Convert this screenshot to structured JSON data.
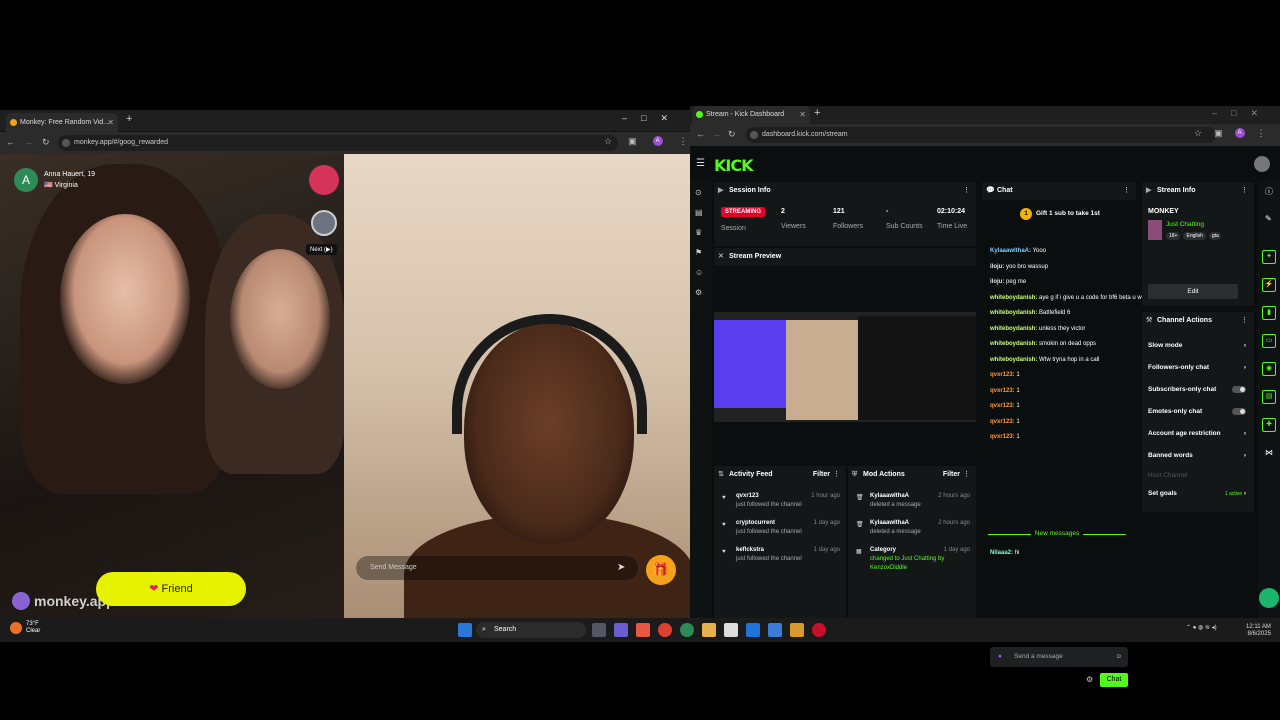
{
  "left_browser": {
    "tab_title": "Monkey: Free Random Vid...",
    "url": "monkey.app/#/goog_rewarded",
    "user_name": "Anna Hauert, 19",
    "user_location": "🇺🇸 Virginia",
    "user_initial": "A",
    "next_tooltip": "Next (▶)",
    "friend_label": "Friend",
    "logo_text": "monkey.app",
    "send_placeholder": "Send Message"
  },
  "right_browser": {
    "tab_title": "Stream - Kick Dashboard",
    "url": "dashboard.kick.com/stream",
    "kick_logo": "KICK",
    "session_info": {
      "title": "Session Info",
      "status": "STREAMING",
      "session_label": "Session",
      "viewers_value": "2",
      "viewers_label": "Viewers",
      "followers_value": "121",
      "followers_label": "Followers",
      "subs_value": "-",
      "subs_label": "Sub Counts",
      "time_value": "02:10:24",
      "time_label": "Time Live"
    },
    "stream_preview_title": "Stream Preview",
    "activity_feed": {
      "title": "Activity Feed",
      "filter": "Filter",
      "items": [
        {
          "name": "qvxr123",
          "text": "just followed the channel",
          "time": "1 hour ago"
        },
        {
          "name": "cryptocurrent",
          "text": "just followed the channel",
          "time": "1 day ago"
        },
        {
          "name": "keflckstra",
          "text": "just followed the channel",
          "time": "1 day ago"
        }
      ]
    },
    "mod_actions": {
      "title": "Mod Actions",
      "filter": "Filter",
      "items": [
        {
          "name": "KylaaawithaA",
          "text": "deleted a message",
          "time": "2 hours ago"
        },
        {
          "name": "KylaaawithaA",
          "text": "deleted a message",
          "time": "2 hours ago"
        },
        {
          "name": "Category",
          "text": "changed to Just Chatting by KenzoxDiddle",
          "time": "1 day ago"
        }
      ]
    },
    "chat": {
      "title": "Chat",
      "pinned": "Gift 1 sub to take 1st",
      "lines": [
        {
          "user": "KylaaawithaA:",
          "msg": "Yooo",
          "color": "#7fd0ff"
        },
        {
          "user": "iloju:",
          "msg": "yoo bro wassup",
          "color": "#e8e8e8"
        },
        {
          "user": "iloju:",
          "msg": "peg me",
          "color": "#e8e8e8"
        },
        {
          "user": "whiteboydanish:",
          "msg": "aye g if i give u a code for bf6 beta u would play wit me",
          "color": "#c8ff7a"
        },
        {
          "user": "whiteboydanish:",
          "msg": "Battlefield 6",
          "color": "#c8ff7a"
        },
        {
          "user": "whiteboydanish:",
          "msg": "unless they victor",
          "color": "#c8ff7a"
        },
        {
          "user": "whiteboydanish:",
          "msg": "smokin on dead opps",
          "color": "#c8ff7a"
        },
        {
          "user": "whiteboydanish:",
          "msg": "Wtw tryna hop in a call",
          "color": "#c8ff7a"
        },
        {
          "user": "qvxr123:",
          "msg": "1",
          "color": "#ff9a3c"
        },
        {
          "user": "qvxr123:",
          "msg": "1",
          "color": "#ff9a3c"
        },
        {
          "user": "qvxr123:",
          "msg": "1",
          "color": "#ff9a3c"
        },
        {
          "user": "qvxr123:",
          "msg": "1",
          "color": "#ff9a3c"
        },
        {
          "user": "qvxr123:",
          "msg": "1",
          "color": "#ff9a3c"
        }
      ],
      "new_messages": "New messages",
      "last_line": {
        "user": "Nilaaa2:",
        "msg": "hi",
        "color": "#7fffd4"
      },
      "input_placeholder": "Send a message",
      "send_label": "Chat"
    },
    "stream_info": {
      "title": "Stream Info",
      "channel": "MONKEY",
      "category": "Just Chatting",
      "tags": [
        "18+",
        "English",
        "gta"
      ],
      "edit": "Edit"
    },
    "channel_actions": {
      "title": "Channel Actions",
      "items": [
        "Slow mode",
        "Followers-only chat",
        "Subscribers-only chat",
        "Emotes-only chat",
        "Account age restriction",
        "Banned words",
        "Host Channel",
        "Set goals"
      ],
      "goals_badge": "1 active"
    }
  },
  "taskbar": {
    "weather_temp": "73°F",
    "weather_text": "Clear",
    "search": "Search",
    "time": "12:11 AM",
    "date": "8/6/2025"
  },
  "colors": {
    "kick_green": "#53fc18",
    "live_red": "#e4002b",
    "friend_yellow": "#e7f200"
  }
}
